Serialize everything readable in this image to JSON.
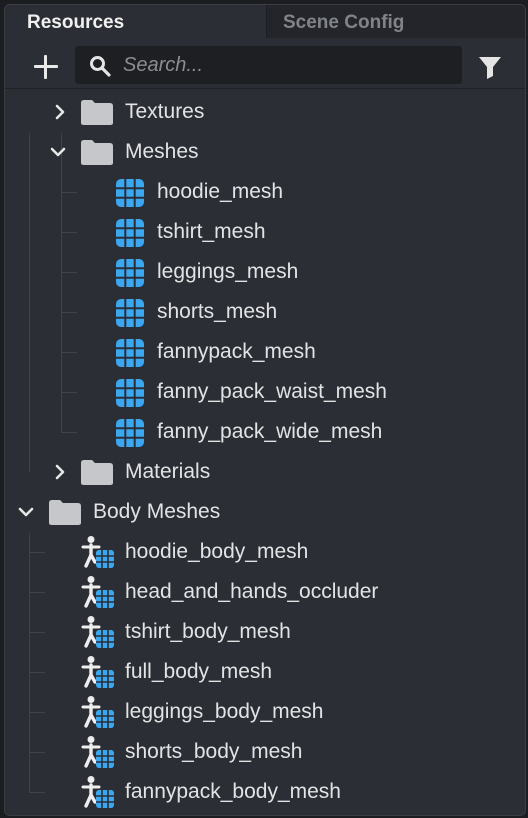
{
  "tabs": {
    "resources": "Resources",
    "scene_config": "Scene Config"
  },
  "toolbar": {
    "search_placeholder": "Search..."
  },
  "tree": {
    "textures": "Textures",
    "meshes": "Meshes",
    "mesh_items": [
      "hoodie_mesh",
      "tshirt_mesh",
      "leggings_mesh",
      "shorts_mesh",
      "fannypack_mesh",
      "fanny_pack_waist_mesh",
      "fanny_pack_wide_mesh"
    ],
    "materials": "Materials",
    "body_meshes": "Body Meshes",
    "body_items": [
      "hoodie_body_mesh",
      "head_and_hands_occluder",
      "tshirt_body_mesh",
      "full_body_mesh",
      "leggings_body_mesh",
      "shorts_body_mesh",
      "fannypack_body_mesh"
    ]
  },
  "colors": {
    "accent_mesh": "#3ba7f0",
    "folder": "#c5c7cb",
    "text": "#e2e3e5"
  },
  "icons": {
    "add": "plus-icon",
    "search": "magnifier-icon",
    "filter": "funnel-icon",
    "folder": "folder-icon",
    "mesh": "mesh-grid-icon",
    "body_mesh": "body-mesh-icon",
    "collapsed": "chevron-right-icon",
    "expanded": "chevron-down-icon"
  }
}
